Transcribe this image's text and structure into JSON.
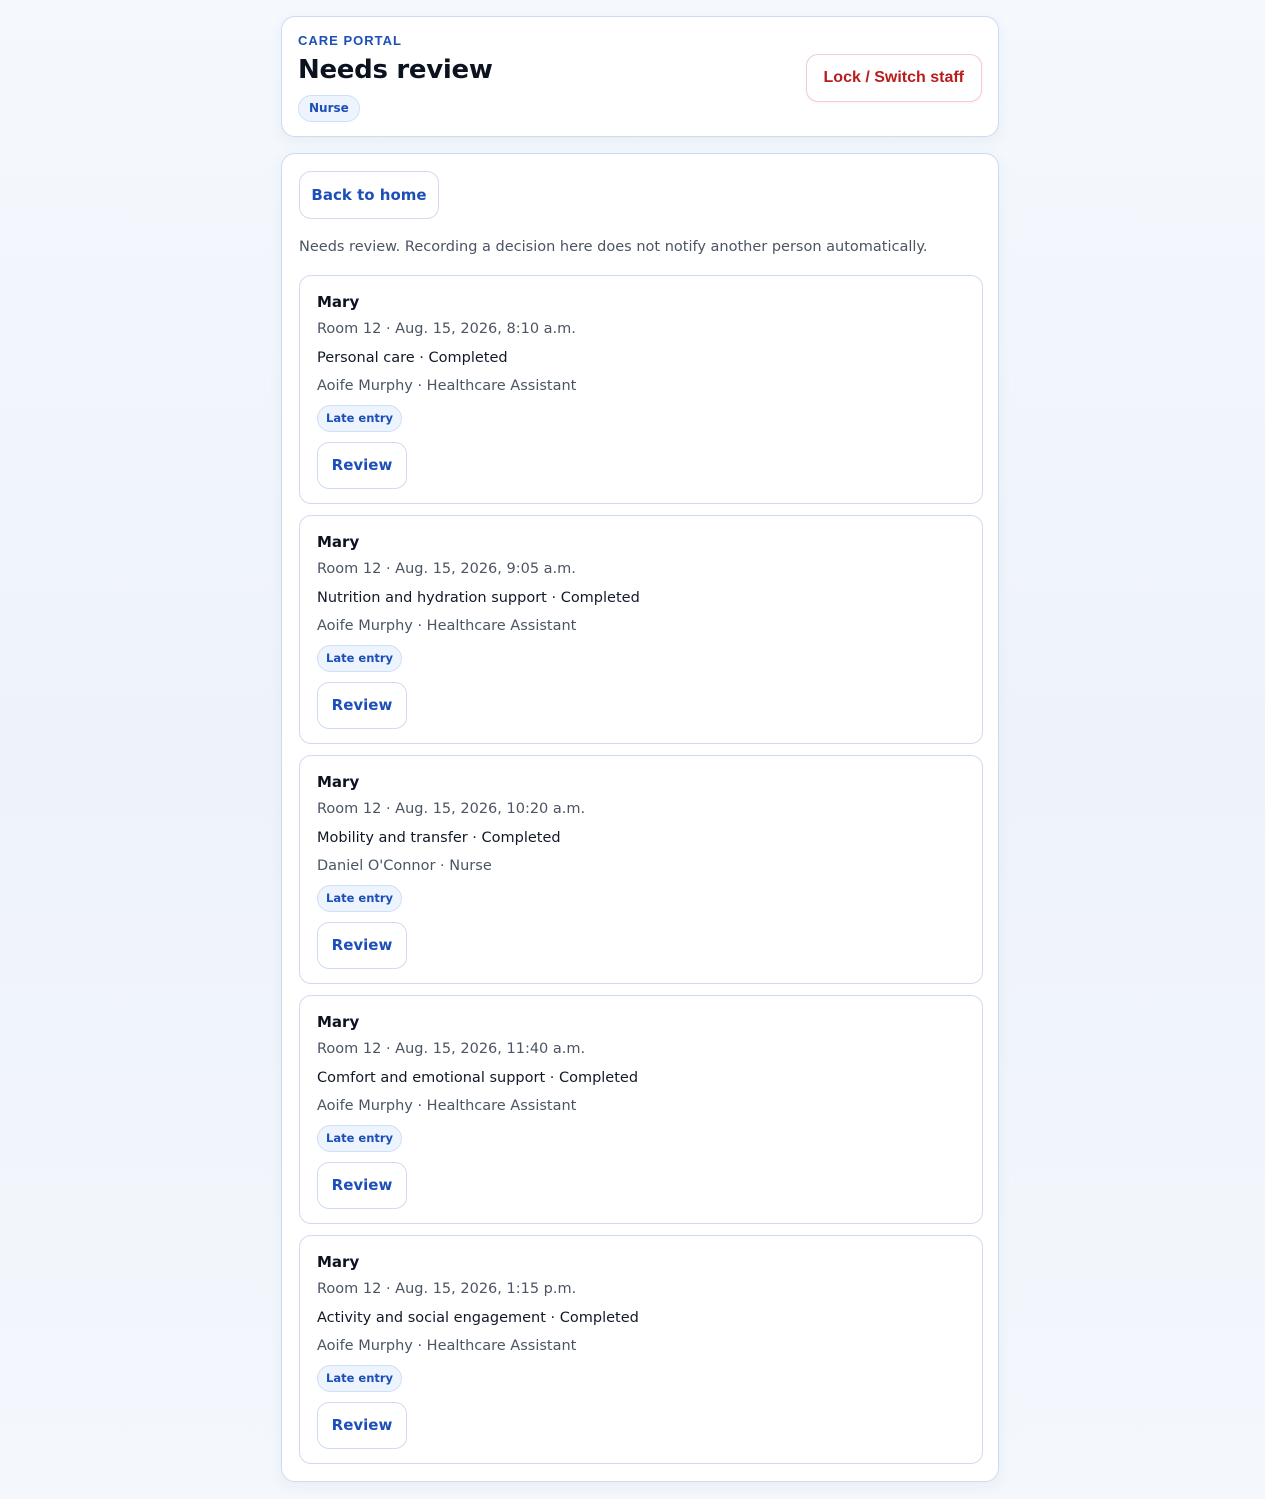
{
  "header": {
    "eyebrow": "CARE PORTAL",
    "title": "Needs review",
    "role_badge": "Nurse",
    "lock_button_label": "Lock / Switch staff"
  },
  "main": {
    "back_button_label": "Back to home",
    "notice": "Needs review. Recording a decision here does not notify another person automatically.",
    "entries": [
      {
        "resident": "Mary",
        "meta": "Room 12 · Aug. 15, 2026, 8:10 a.m.",
        "task": "Personal care · Completed",
        "staff": "Aoife Murphy · Healthcare Assistant",
        "badge": "Late entry",
        "action_label": "Review"
      },
      {
        "resident": "Mary",
        "meta": "Room 12 · Aug. 15, 2026, 9:05 a.m.",
        "task": "Nutrition and hydration support · Completed",
        "staff": "Aoife Murphy · Healthcare Assistant",
        "badge": "Late entry",
        "action_label": "Review"
      },
      {
        "resident": "Mary",
        "meta": "Room 12 · Aug. 15, 2026, 10:20 a.m.",
        "task": "Mobility and transfer · Completed",
        "staff": "Daniel O'Connor · Nurse",
        "badge": "Late entry",
        "action_label": "Review"
      },
      {
        "resident": "Mary",
        "meta": "Room 12 · Aug. 15, 2026, 11:40 a.m.",
        "task": "Comfort and emotional support · Completed",
        "staff": "Aoife Murphy · Healthcare Assistant",
        "badge": "Late entry",
        "action_label": "Review"
      },
      {
        "resident": "Mary",
        "meta": "Room 12 · Aug. 15, 2026, 1:15 p.m.",
        "task": "Activity and social engagement · Completed",
        "staff": "Aoife Murphy · Healthcare Assistant",
        "badge": "Late entry",
        "action_label": "Review"
      }
    ]
  },
  "colors": {
    "accent": "#1d4fb8",
    "danger": "#b91c1c",
    "border": "#cfdcf0",
    "badge_bg": "#eef4fd"
  }
}
